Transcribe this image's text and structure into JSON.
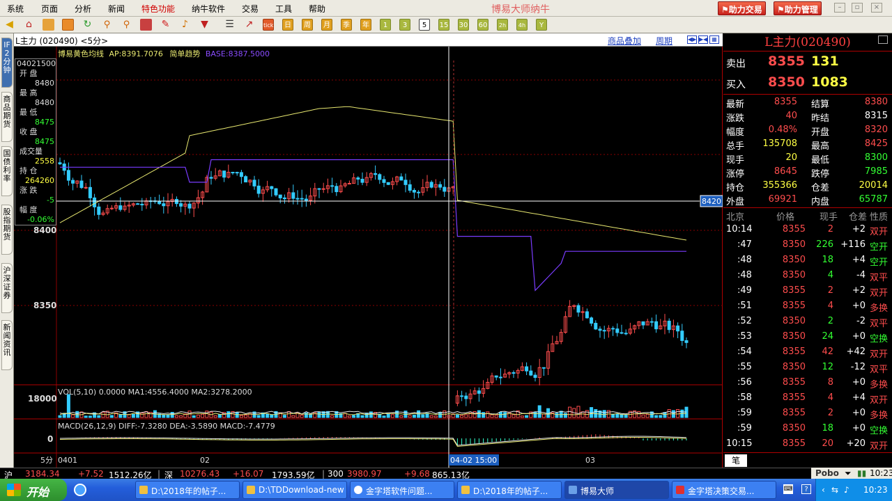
{
  "menu": {
    "items": [
      "系统",
      "页面",
      "分析",
      "新闻",
      "特色功能",
      "纳牛软件",
      "交易",
      "工具",
      "帮助"
    ],
    "app_title": "博易大师纳牛",
    "assist_trade": "助力交易",
    "assist_manage": "助力管理"
  },
  "toolbar": {
    "periods": [
      "tick",
      "日",
      "周",
      "月",
      "季",
      "年",
      "1",
      "3",
      "5",
      "15",
      "30",
      "60",
      "2h",
      "4h",
      "Y"
    ],
    "active_period": "5"
  },
  "vtabs": [
    "IF2分钟",
    "商品期货",
    "国债利率",
    "股指期货",
    "沪深证券",
    "新闻资讯"
  ],
  "chart": {
    "header_title": "L主力 (020490) <5分>",
    "overlay_link": "商品叠加",
    "period_link": "周期",
    "indicator_line": {
      "name": "博易黄色均线",
      "ap": "AP:8391.7076",
      "trend": "简单趋势",
      "base": "BASE:8387.5000"
    },
    "price_levels": [
      "8400",
      "8350"
    ],
    "crosshair_price": "8420",
    "vol_header": "VOL(5,10) 0.0000 MA1:4556.4000 MA2:3278.2000",
    "vol_axis": "18000",
    "macd_header": "MACD(26,12,9) DIFF:-7.3280 DEA:-3.5890 MACD:-7.4779",
    "macd_axis": "0",
    "x_labels": [
      "5分",
      "0401",
      "02",
      "03"
    ],
    "crosshair_time": "04-02 15:00"
  },
  "info_box": {
    "time": "04021500",
    "rows": [
      {
        "label": "开  盘",
        "value": "8480",
        "color": "#dddddd"
      },
      {
        "label": "最  高",
        "value": "8480",
        "color": "#dddddd"
      },
      {
        "label": "最  低",
        "value": "8475",
        "color": "#33ff33"
      },
      {
        "label": "收  盘",
        "value": "8475",
        "color": "#33ff33"
      },
      {
        "label": "成交量",
        "value": "2558",
        "color": "#ffff44"
      },
      {
        "label": "持  仓",
        "value": "264260",
        "color": "#ffff44"
      },
      {
        "label": "涨  跌",
        "value": "-5",
        "color": "#33ff33"
      },
      {
        "label": "幅  度",
        "value": "-0.06%",
        "color": "#33ff33"
      }
    ]
  },
  "quote": {
    "title": "L主力(020490)",
    "sell_label": "卖出",
    "sell_price": "8355",
    "sell_vol": "131",
    "buy_label": "买入",
    "buy_price": "8350",
    "buy_vol": "1083",
    "rows": [
      {
        "l1": "最新",
        "v1": "8355",
        "c1": "red",
        "l2": "结算",
        "v2": "8380",
        "c2": "red"
      },
      {
        "l1": "涨跌",
        "v1": "40",
        "c1": "red",
        "l2": "昨结",
        "v2": "8315",
        "c2": "white"
      },
      {
        "l1": "幅度",
        "v1": "0.48%",
        "c1": "red",
        "l2": "开盘",
        "v2": "8320",
        "c2": "red"
      },
      {
        "l1": "总手",
        "v1": "135708",
        "c1": "yellow",
        "l2": "最高",
        "v2": "8425",
        "c2": "red"
      },
      {
        "l1": "现手",
        "v1": "20",
        "c1": "yellow",
        "l2": "最低",
        "v2": "8300",
        "c2": "green"
      },
      {
        "l1": "涨停",
        "v1": "8645",
        "c1": "red",
        "l2": "跌停",
        "v2": "7985",
        "c2": "green"
      },
      {
        "l1": "持仓",
        "v1": "355366",
        "c1": "yellow",
        "l2": "仓差",
        "v2": "20014",
        "c2": "yellow"
      },
      {
        "l1": "外盘",
        "v1": "69921",
        "c1": "red",
        "l2": "内盘",
        "v2": "65787",
        "c2": "green"
      }
    ],
    "tick_headers": [
      "北京",
      "价格",
      "现手",
      "仓差",
      "性质"
    ],
    "ticks": [
      {
        "time": "10:14",
        "price": "8355",
        "pc": "red",
        "vol": "2",
        "vc": "red",
        "diff": "+2",
        "nature": "双开",
        "nc": "red"
      },
      {
        "time": ":47",
        "price": "8350",
        "pc": "red",
        "vol": "226",
        "vc": "green",
        "diff": "+116",
        "nature": "空开",
        "nc": "green"
      },
      {
        "time": ":48",
        "price": "8350",
        "pc": "red",
        "vol": "18",
        "vc": "green",
        "diff": "+4",
        "nature": "空开",
        "nc": "green"
      },
      {
        "time": ":48",
        "price": "8350",
        "pc": "red",
        "vol": "4",
        "vc": "green",
        "diff": "-4",
        "nature": "双平",
        "nc": "red"
      },
      {
        "time": ":49",
        "price": "8355",
        "pc": "red",
        "vol": "2",
        "vc": "red",
        "diff": "+2",
        "nature": "双开",
        "nc": "red"
      },
      {
        "time": ":51",
        "price": "8355",
        "pc": "red",
        "vol": "4",
        "vc": "red",
        "diff": "+0",
        "nature": "多换",
        "nc": "red"
      },
      {
        "time": ":52",
        "price": "8350",
        "pc": "red",
        "vol": "2",
        "vc": "green",
        "diff": "-2",
        "nature": "双平",
        "nc": "red"
      },
      {
        "time": ":53",
        "price": "8350",
        "pc": "red",
        "vol": "24",
        "vc": "green",
        "diff": "+0",
        "nature": "空换",
        "nc": "green"
      },
      {
        "time": ":54",
        "price": "8355",
        "pc": "red",
        "vol": "42",
        "vc": "red",
        "diff": "+42",
        "nature": "双开",
        "nc": "red"
      },
      {
        "time": ":55",
        "price": "8350",
        "pc": "red",
        "vol": "12",
        "vc": "green",
        "diff": "-12",
        "nature": "双平",
        "nc": "red"
      },
      {
        "time": ":56",
        "price": "8355",
        "pc": "red",
        "vol": "8",
        "vc": "red",
        "diff": "+0",
        "nature": "多换",
        "nc": "red"
      },
      {
        "time": ":58",
        "price": "8355",
        "pc": "red",
        "vol": "4",
        "vc": "red",
        "diff": "+4",
        "nature": "双开",
        "nc": "red"
      },
      {
        "time": ":59",
        "price": "8355",
        "pc": "red",
        "vol": "2",
        "vc": "red",
        "diff": "+0",
        "nature": "多换",
        "nc": "red"
      },
      {
        "time": ":59",
        "price": "8350",
        "pc": "red",
        "vol": "18",
        "vc": "green",
        "diff": "+0",
        "nature": "空换",
        "nc": "green"
      },
      {
        "time": "10:15",
        "price": "8355",
        "pc": "red",
        "vol": "20",
        "vc": "red",
        "diff": "+20",
        "nature": "双开",
        "nc": "red"
      }
    ],
    "footer_tab": "笔"
  },
  "status": {
    "sh_label": "沪",
    "sh_index": "3184.34",
    "sh_change": "+7.52",
    "sh_amount": "1512.26亿",
    "sz_label": "深",
    "sz_index": "10276.43",
    "sz_change": "+16.07",
    "sz_amount": "1793.59亿",
    "c300_label": "300",
    "c300_index": "3980.97",
    "c300_change": "+9.68",
    "c300_amount": "865.13亿",
    "pobo": "Pobo",
    "time": "10:23"
  },
  "taskbar": {
    "start": "开始",
    "tasks": [
      "D:\\2018年的帖子...",
      "D:\\TDDownload-new",
      "金字塔软件问题...",
      "D:\\2018年的帖子...",
      "博易大师",
      "金字塔决策交易..."
    ],
    "active_task": "博易大师",
    "clock": "10:23"
  },
  "colors": {
    "up": "#ff4d4d",
    "down": "#33ccff",
    "ma_yellow": "#e8e870",
    "ma_purple": "#7a3cff",
    "grid": "#8b0000"
  }
}
